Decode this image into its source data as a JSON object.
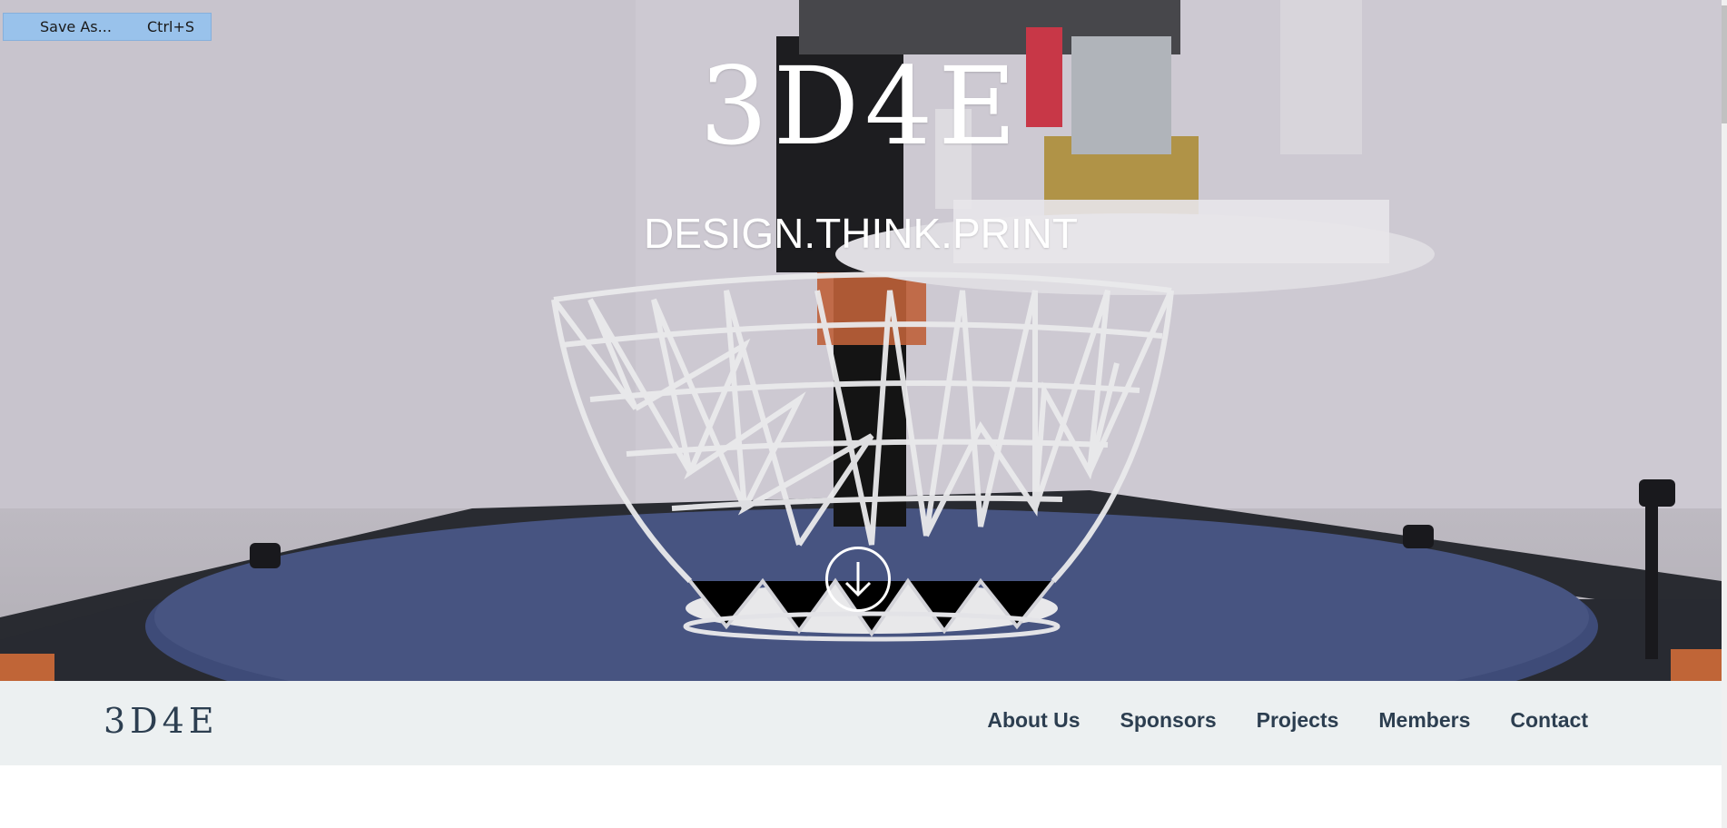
{
  "context_menu": {
    "label": "Save As...",
    "shortcut": "Ctrl+S"
  },
  "hero": {
    "title": "3D4E",
    "tagline": "DESIGN.THINK.PRINT",
    "scroll_icon": "arrow-down-circle-icon"
  },
  "navbar": {
    "brand": "3D4E",
    "links": [
      "About Us",
      "Sponsors",
      "Projects",
      "Members",
      "Contact"
    ]
  },
  "colors": {
    "nav_bg": "#ecf0f1",
    "nav_text": "#2c3e50",
    "menu_highlight": "#99c2eb"
  }
}
